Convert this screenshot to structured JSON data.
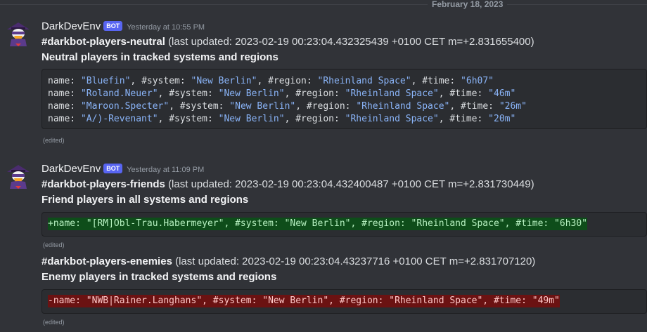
{
  "date_divider": "February 18, 2023",
  "messages": [
    {
      "username": "DarkDevEnv",
      "bot_tag": "BOT",
      "timestamp": "Yesterday at 10:55 PM",
      "avatar_icon": "darkwing-duck-avatar-icon",
      "channel": "#darkbot-players-neutral",
      "updated": "(last updated: 2023-02-19 00:23:04.432325439 +0100 CET m=+2.831655400)",
      "subtitle": "Neutral players in tracked systems and regions",
      "rows": [
        {
          "name": "\"Bluefin\"",
          "system": "\"New Berlin\"",
          "region": "\"Rheinland Space\"",
          "time": "\"6h07\""
        },
        {
          "name": "\"Roland.Neuer\"",
          "system": "\"New Berlin\"",
          "region": "\"Rheinland Space\"",
          "time": "\"46m\""
        },
        {
          "name": "\"Maroon.Specter\"",
          "system": "\"New Berlin\"",
          "region": "\"Rheinland Space\"",
          "time": "\"26m\""
        },
        {
          "name": "\"A/)-Revenant\"",
          "system": "\"New Berlin\"",
          "region": "\"Rheinland Space\"",
          "time": "\"20m\""
        }
      ],
      "edited": "(edited)"
    },
    {
      "username": "DarkDevEnv",
      "bot_tag": "BOT",
      "timestamp": "Yesterday at 11:09 PM",
      "avatar_icon": "darkwing-duck-avatar-icon",
      "channel": "#darkbot-players-friends",
      "updated": "(last updated: 2023-02-19 00:23:04.432400487 +0100 CET m=+2.831730449)",
      "subtitle": "Friend players in all systems and regions",
      "diff_line": "+name: \"[RM]Obl-Trau.Habermeyer\", #system: \"New Berlin\", #region: \"Rheinland Space\", #time: \"6h30\"",
      "edited": "(edited)"
    },
    {
      "channel": "#darkbot-players-enemies",
      "updated": "(last updated: 2023-02-19 00:23:04.43237716 +0100 CET m=+2.831707120)",
      "subtitle": "Enemy players in tracked systems and regions",
      "diff_line": "-name: \"NWB|Rainer.Langhans\", #system: \"New Berlin\", #region: \"Rheinland Space\", #time: \"49m\"",
      "edited": "(edited)"
    }
  ],
  "code_keys": {
    "name": "name: ",
    "system": ", #system: ",
    "region": ", #region: ",
    "time": ", #time: "
  },
  "colors": {
    "background": "#313338",
    "code_bg": "#2b2d31",
    "string": "#8ab4f8",
    "diff_add_bg": "#0e4d1a",
    "diff_del_bg": "#6b1212",
    "bot_tag": "#5865f2"
  }
}
